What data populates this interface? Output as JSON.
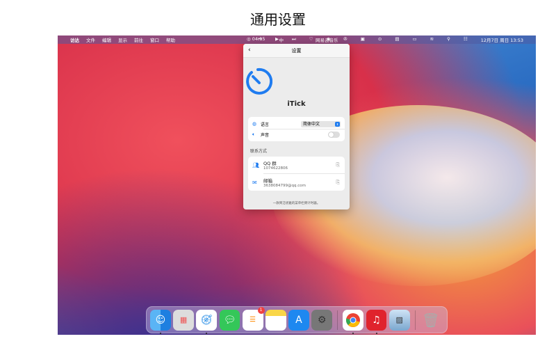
{
  "title": "通用设置",
  "menubar": {
    "apple": "",
    "items": [
      "访达",
      "文件",
      "编辑",
      "显示",
      "前往",
      "窗口",
      "帮助"
    ],
    "timer": "◎ 04:15",
    "input": "中",
    "now_playing": "网易云音乐",
    "datetime": "12月7日 周日 13:53"
  },
  "panel": {
    "title": "设置",
    "back": "‹",
    "app_name": "iTick",
    "language_label": "语言",
    "language_value": "简体中文",
    "sound_label": "声音",
    "sound_on": false,
    "contact_header": "联系方式",
    "contacts": [
      {
        "label": "QQ 群",
        "value": "1074622806"
      },
      {
        "label": "邮箱",
        "value": "3638084799@qq.com"
      }
    ],
    "footer": "一款简洁优雅的菜单栏倒计时器。"
  },
  "dock": {
    "reminders_badge": "1"
  },
  "colors": {
    "accent": "#1f7cf0"
  }
}
